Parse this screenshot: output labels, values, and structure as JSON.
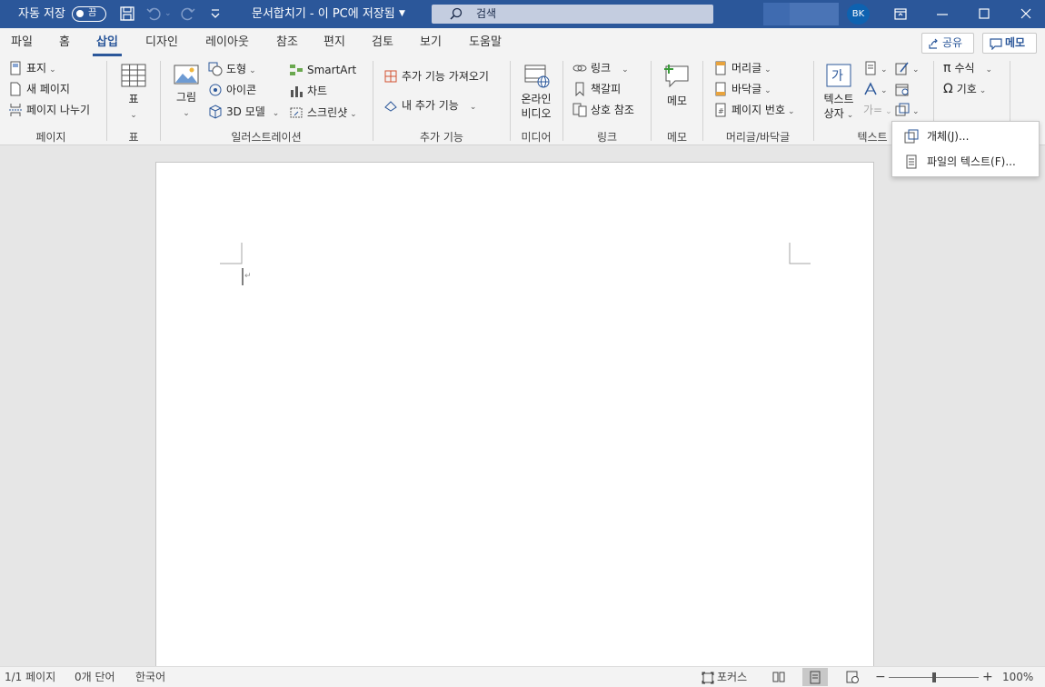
{
  "titlebar": {
    "autosave_label": "자동 저장",
    "autosave_state": "끔",
    "doc_title": "문서합치기 - 이 PC에 저장됨",
    "search_placeholder": "검색",
    "avatar_initials": "BK",
    "bg_color": "#2b579a"
  },
  "tabs": [
    "파일",
    "홈",
    "삽입",
    "디자인",
    "레이아웃",
    "참조",
    "편지",
    "검토",
    "보기",
    "도움말"
  ],
  "active_tab": "삽입",
  "share_label": "공유",
  "memo_button_label": "메모",
  "ribbon": {
    "pages": {
      "cover": "표지",
      "new_page": "새 페이지",
      "page_break": "페이지 나누기",
      "group": "페이지"
    },
    "table": {
      "label": "표",
      "group": "표"
    },
    "illustrations": {
      "picture": "그림",
      "shapes": "도형",
      "icons": "아이콘",
      "model3d": "3D 모델",
      "smartart": "SmartArt",
      "chart": "차트",
      "screenshot": "스크린샷",
      "group": "일러스트레이션"
    },
    "addins": {
      "get": "추가 기능 가져오기",
      "my": "내 추가 기능",
      "group": "추가 기능"
    },
    "media": {
      "video_l1": "온라인",
      "video_l2": "비디오",
      "group": "미디어"
    },
    "links": {
      "link": "링크",
      "bookmark": "책갈피",
      "cross_ref": "상호 참조",
      "group": "링크"
    },
    "comments": {
      "comment": "메모",
      "group": "메모"
    },
    "header_footer": {
      "header": "머리글",
      "footer": "바닥글",
      "page_number": "페이지 번호",
      "group": "머리글/바닥글"
    },
    "text": {
      "textbox_l1": "텍스트",
      "textbox_l2": "상자",
      "dropcap": "가",
      "group": "텍스트"
    },
    "symbols": {
      "equation": "수식",
      "symbol": "기호"
    }
  },
  "object_menu": {
    "items": [
      "개체(J)...",
      "파일의 텍스트(F)..."
    ]
  },
  "statusbar": {
    "page": "1/1 페이지",
    "words": "0개 단어",
    "language": "한국어",
    "focus": "포커스",
    "zoom": "100%",
    "zoom_level": 1.0
  }
}
